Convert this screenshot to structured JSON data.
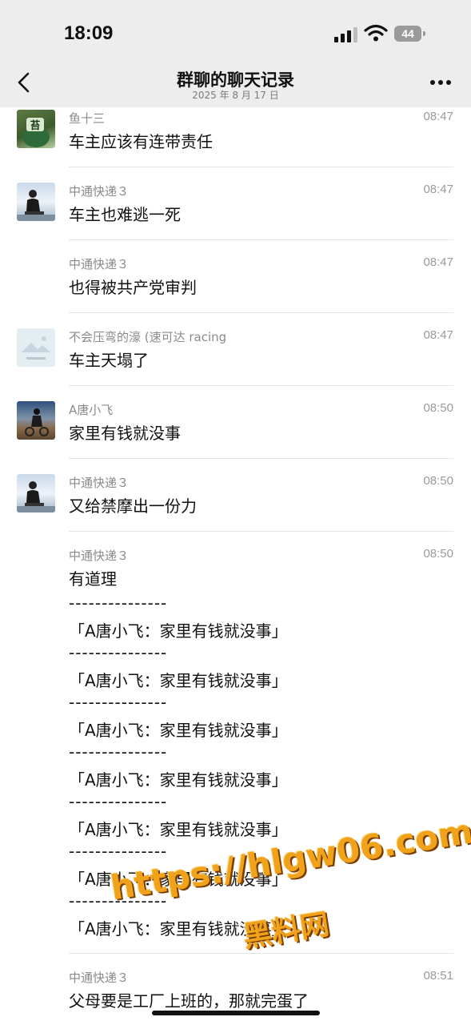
{
  "status": {
    "time": "18:09",
    "battery": "44"
  },
  "nav": {
    "title": "群聊的聊天记录",
    "date": "2025 年 8 月 17 日"
  },
  "messages": [
    {
      "sender": "鱼十三",
      "time": "08:47",
      "text": "车主应该有连带责任"
    },
    {
      "sender": "中通快递３",
      "time": "08:47",
      "text": "车主也难逃一死"
    },
    {
      "sender": "中通快递３",
      "time": "08:47",
      "text": "也得被共产党审判"
    },
    {
      "sender": "不会压弯的濠 (速可达 racing",
      "time": "08:47",
      "text": "车主天塌了"
    },
    {
      "sender": "A唐小飞",
      "time": "08:50",
      "text": "家里有钱就没事"
    },
    {
      "sender": "中通快递３",
      "time": "08:50",
      "text": "又给禁摩出一份力"
    },
    {
      "sender": "中通快递３",
      "time": "08:50",
      "text": "有道理"
    },
    {
      "sender": "中通快递３",
      "time": "08:51",
      "text": "父母要是工厂上班的，那就完蛋了"
    }
  ],
  "long_message": {
    "separator": "---------------",
    "quote": "「A唐小飞：家里有钱就没事」"
  },
  "watermark": {
    "url": "https://hlgw06.com",
    "name": "黑料网"
  },
  "colors": {
    "header_bg": "#ededed",
    "watermark": "#f0a21a"
  }
}
